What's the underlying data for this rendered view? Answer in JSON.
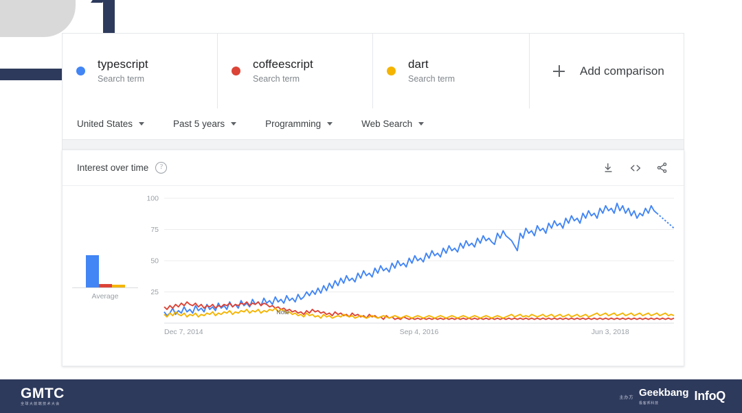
{
  "decor": {
    "corner_shape": "rounded-arc",
    "navy": "#2e3a5c",
    "gray": "#d9d9d9"
  },
  "comparison": {
    "terms": [
      {
        "name": "typescript",
        "subtitle": "Search term",
        "color": "#4285F4"
      },
      {
        "name": "coffeescript",
        "subtitle": "Search term",
        "color": "#DB4437"
      },
      {
        "name": "dart",
        "subtitle": "Search term",
        "color": "#F4B400"
      }
    ],
    "add_label": "Add comparison"
  },
  "filters": [
    {
      "label": "United States"
    },
    {
      "label": "Past 5 years"
    },
    {
      "label": "Programming"
    },
    {
      "label": "Web Search"
    }
  ],
  "chart_card": {
    "title": "Interest over time",
    "help_glyph": "?",
    "actions": [
      {
        "name": "download-icon"
      },
      {
        "name": "embed-code-icon"
      },
      {
        "name": "share-icon"
      }
    ]
  },
  "chart_data": {
    "type": "line",
    "title": "Interest over time",
    "xlabel": "",
    "ylabel": "",
    "ylim": [
      0,
      100
    ],
    "yticks": [
      25,
      50,
      75,
      100
    ],
    "grid": true,
    "legend_position": "top",
    "xtick_labels": [
      "Dec 7, 2014",
      "Sep 4, 2016",
      "Jun 3, 2018"
    ],
    "xtick_positions": [
      0,
      0.5,
      0.875
    ],
    "annotations": [
      {
        "text": "Note",
        "x": 0.22,
        "y": 6
      }
    ],
    "partial_data_dashed_tail": true,
    "average_bar_chart": {
      "type": "bar",
      "label": "Average",
      "categories": [
        "typescript",
        "coffeescript",
        "dart"
      ],
      "values": [
        53,
        6,
        5
      ],
      "colors": [
        "#4285F4",
        "#DB4437",
        "#F4B400"
      ]
    },
    "series": [
      {
        "name": "typescript",
        "color": "#4285F4",
        "values": [
          9,
          6,
          8,
          12,
          7,
          10,
          8,
          13,
          9,
          11,
          8,
          14,
          10,
          12,
          9,
          15,
          11,
          13,
          10,
          16,
          12,
          14,
          11,
          17,
          13,
          15,
          12,
          18,
          14,
          16,
          13,
          19,
          15,
          17,
          14,
          20,
          16,
          18,
          15,
          21,
          17,
          19,
          16,
          22,
          18,
          20,
          17,
          23,
          19,
          21,
          25,
          22,
          26,
          23,
          28,
          24,
          30,
          26,
          32,
          28,
          34,
          30,
          36,
          32,
          38,
          34,
          36,
          33,
          40,
          36,
          42,
          38,
          40,
          37,
          44,
          40,
          46,
          42,
          44,
          41,
          48,
          44,
          50,
          46,
          48,
          45,
          52,
          48,
          54,
          50,
          52,
          49,
          56,
          52,
          58,
          54,
          56,
          53,
          60,
          56,
          62,
          58,
          60,
          57,
          64,
          60,
          66,
          62,
          64,
          61,
          68,
          64,
          70,
          66,
          68,
          65,
          63,
          72,
          68,
          74,
          70,
          68,
          66,
          62,
          58,
          72,
          68,
          76,
          72,
          74,
          70,
          78,
          74,
          76,
          72,
          80,
          76,
          82,
          78,
          80,
          76,
          84,
          80,
          86,
          82,
          84,
          80,
          88,
          84,
          90,
          86,
          88,
          84,
          92,
          88,
          94,
          90,
          92,
          88,
          96,
          90,
          94,
          88,
          92,
          86,
          90,
          84,
          88,
          86,
          92,
          88,
          94,
          90,
          88,
          86,
          84,
          82,
          80,
          78,
          76
        ]
      },
      {
        "name": "coffeescript",
        "color": "#DB4437",
        "values": [
          13,
          11,
          14,
          12,
          15,
          13,
          16,
          14,
          17,
          15,
          14,
          16,
          13,
          15,
          12,
          14,
          13,
          15,
          12,
          14,
          13,
          15,
          14,
          16,
          13,
          15,
          14,
          16,
          15,
          17,
          14,
          16,
          15,
          17,
          14,
          16,
          15,
          13,
          14,
          12,
          13,
          11,
          12,
          10,
          11,
          9,
          10,
          8,
          9,
          7,
          10,
          8,
          11,
          9,
          10,
          8,
          9,
          7,
          8,
          6,
          9,
          7,
          8,
          6,
          7,
          5,
          8,
          6,
          7,
          5,
          6,
          4,
          7,
          5,
          6,
          4,
          5,
          3,
          6,
          4,
          5,
          3,
          4,
          3,
          5,
          4,
          3,
          4,
          3,
          4,
          3,
          4,
          3,
          4,
          3,
          4,
          3,
          4,
          3,
          4,
          3,
          4,
          3,
          4,
          3,
          4,
          3,
          4,
          3,
          4,
          3,
          4,
          3,
          4,
          3,
          4,
          3,
          4,
          3,
          4,
          3,
          4,
          3,
          4,
          3,
          4,
          3,
          4,
          3,
          4,
          3,
          4,
          3,
          4,
          3,
          4,
          3,
          4,
          3,
          4,
          3,
          4,
          3,
          4,
          3,
          4,
          3,
          4,
          3,
          4,
          3,
          4,
          3,
          4,
          3,
          4,
          3,
          4,
          3,
          4,
          3,
          4,
          3,
          4,
          3,
          4,
          3,
          4,
          3,
          4,
          3,
          4,
          3,
          4,
          3,
          4,
          3,
          4,
          3,
          4
        ]
      },
      {
        "name": "dart",
        "color": "#F4B400",
        "values": [
          7,
          5,
          8,
          6,
          9,
          7,
          6,
          8,
          5,
          7,
          6,
          8,
          5,
          7,
          6,
          8,
          7,
          9,
          6,
          8,
          7,
          9,
          8,
          10,
          7,
          9,
          8,
          10,
          9,
          11,
          8,
          10,
          9,
          11,
          8,
          10,
          9,
          11,
          10,
          12,
          9,
          11,
          10,
          8,
          9,
          7,
          8,
          6,
          7,
          5,
          8,
          6,
          7,
          5,
          6,
          4,
          7,
          5,
          6,
          4,
          5,
          6,
          5,
          7,
          6,
          5,
          6,
          4,
          5,
          6,
          5,
          4,
          5,
          6,
          5,
          4,
          5,
          6,
          5,
          4,
          5,
          6,
          5,
          4,
          5,
          6,
          5,
          4,
          5,
          6,
          5,
          4,
          5,
          6,
          5,
          4,
          5,
          6,
          5,
          4,
          5,
          6,
          5,
          4,
          5,
          6,
          5,
          4,
          5,
          6,
          5,
          4,
          5,
          6,
          5,
          4,
          5,
          6,
          5,
          4,
          5,
          6,
          7,
          5,
          6,
          7,
          5,
          6,
          5,
          7,
          6,
          5,
          6,
          7,
          5,
          6,
          7,
          5,
          6,
          7,
          5,
          6,
          7,
          5,
          6,
          7,
          5,
          6,
          7,
          5,
          6,
          7,
          8,
          6,
          7,
          8,
          6,
          7,
          8,
          6,
          7,
          8,
          6,
          7,
          8,
          6,
          7,
          8,
          6,
          7,
          8,
          6,
          7,
          8,
          6,
          7,
          8,
          6,
          7,
          6
        ]
      }
    ]
  },
  "footer": {
    "brand": "GMTC",
    "brand_sub": "全球大前端技术大会",
    "host_label": "主办方",
    "geekbang": "Geekbang",
    "geekbang_sub": "极客邦科技",
    "infoq": "InfoQ"
  }
}
